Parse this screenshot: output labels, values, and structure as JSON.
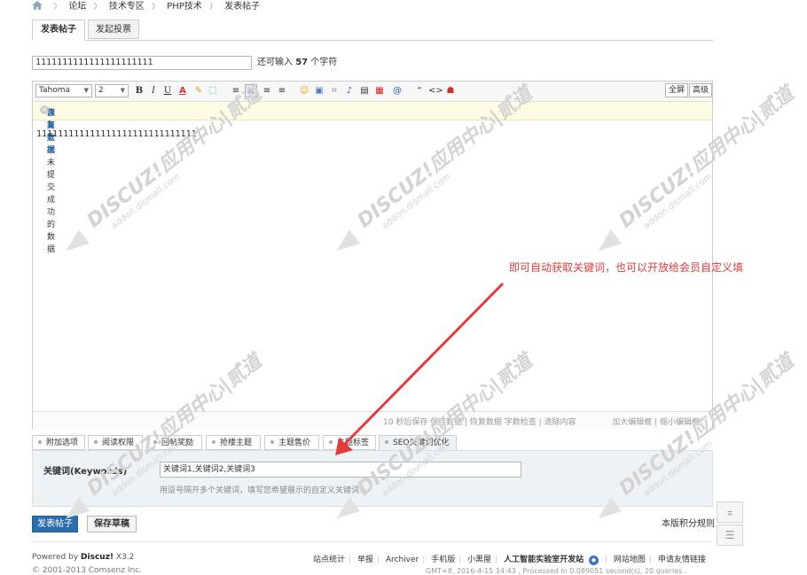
{
  "breadcrumb": {
    "items": [
      "论坛",
      "技术专区",
      "PHP技术",
      "发表帖子"
    ]
  },
  "post_tabs": [
    "发表帖子",
    "发起投票"
  ],
  "subject": {
    "value": "1111111111111111111111",
    "hint_prefix": "还可输入",
    "remaining": "57",
    "hint_suffix": "个字符"
  },
  "toolbar": {
    "font": "Tahoma",
    "size": "2",
    "fullscreen": "全屏",
    "advanced": "高级",
    "buttons": [
      "B",
      "I",
      "U",
      "A",
      "✎",
      "⬚",
      "≡",
      "≡",
      "≡",
      "≡",
      "☺",
      "▣",
      "⌗",
      "♪",
      "▤",
      "▦",
      "@",
      "“",
      "<>",
      "☗"
    ]
  },
  "notice": {
    "text": "您有上次未提交成功的数据",
    "link": "恢复数据"
  },
  "editor_content": "111111111111111111111111111111",
  "editor_status": {
    "left": "10 秒后保存 保存数据 | 恢复数据    字数检查 | 清除内容",
    "right": "加大编辑框 | 缩小编辑框"
  },
  "extra_tabs": [
    "附加选项",
    "阅读权限",
    "回帖奖励",
    "抢楼主题",
    "主题售价",
    "主题标签",
    "SEO关键词优化"
  ],
  "seo": {
    "label": "关键词(Keywords)",
    "value": "关键词1,关键词2,关键词3",
    "hint": "用逗号隔开多个关键词，填写您希望展示的自定义关键词！"
  },
  "actions": {
    "publish": "发表帖子",
    "draft": "保存草稿",
    "rules": "本版积分规则"
  },
  "footer": {
    "powered_prefix": "Powered by",
    "brand": "Discuz!",
    "version": "X3.2",
    "copyright": "© 2001-2013 Comsenz Inc.",
    "links": [
      "站点统计",
      "举报",
      "Archiver",
      "手机版",
      "小黑屋",
      "人工智能实验室开发站",
      "网站地图",
      "申请友情链接"
    ],
    "sub": "GMT+8, 2016-4-15 14:43 , Processed in 0.089051 second(s), 20 queries ."
  },
  "annotation": {
    "text": "即可自动获取关键词，也可以开放给会员自定义填"
  },
  "watermark": {
    "brand": "DISCUZ!应用中心|贰道",
    "domain": "addon.dismall.com"
  },
  "colors": {
    "accent": "#2e6dad",
    "annotation": "#e23b3b",
    "notice_bg": "#fffbe3",
    "panel_bg": "#edf2f7"
  }
}
